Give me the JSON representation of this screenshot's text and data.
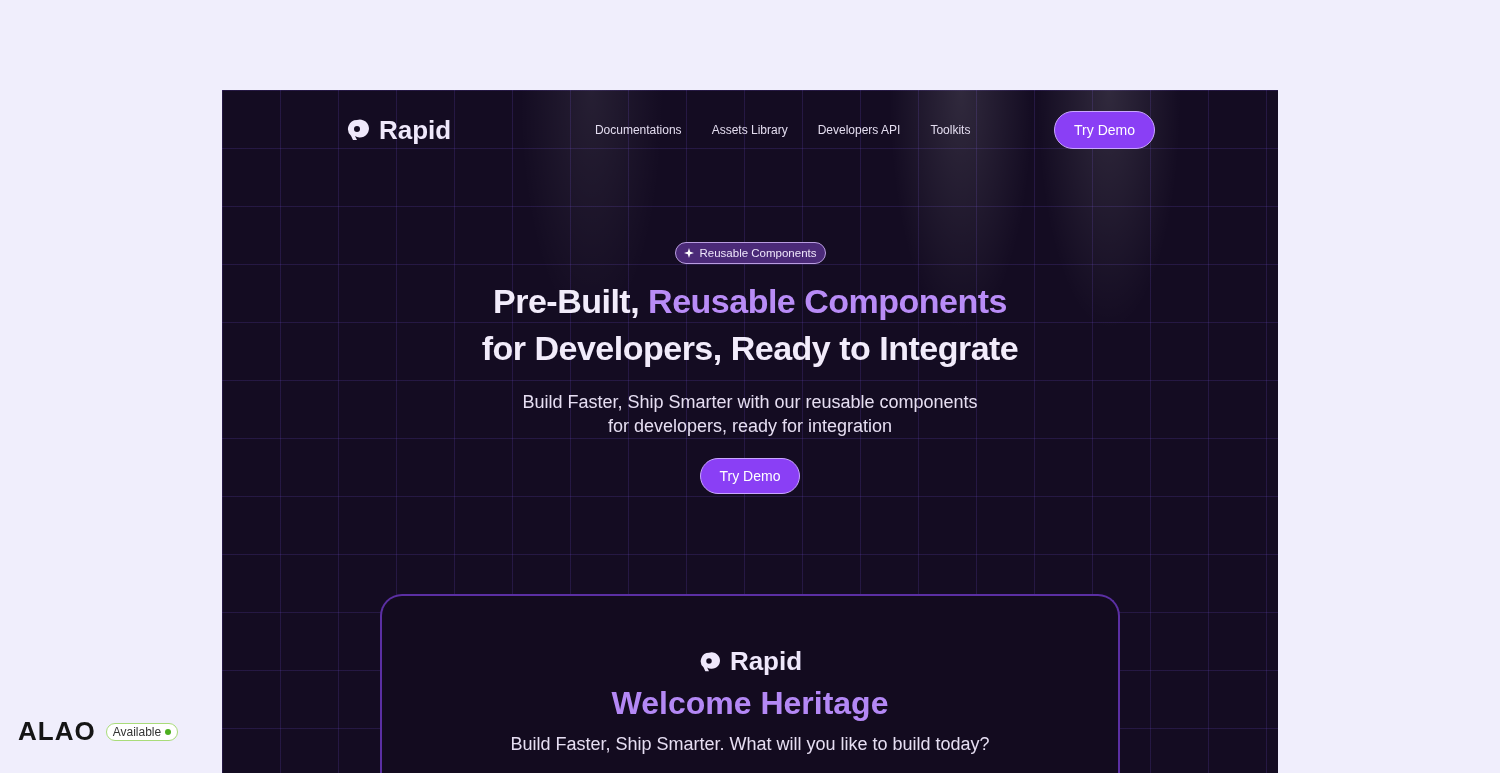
{
  "nav": {
    "brand": "Rapid",
    "links": [
      "Documentations",
      "Assets Library",
      "Developers API",
      "Toolkits"
    ],
    "cta": "Try Demo"
  },
  "hero": {
    "badge": "Reusable Components",
    "headline": [
      [
        {
          "text": "Pre-Built, ",
          "accent": false
        },
        {
          "text": "Reusable Components",
          "accent": true
        }
      ],
      [
        {
          "text": "for Developers, Ready to Integrate",
          "accent": false
        }
      ]
    ],
    "subtitle": [
      "Build Faster, Ship Smarter with our reusable components",
      "for developers, ready for integration"
    ],
    "cta": "Try Demo"
  },
  "card": {
    "brand": "Rapid",
    "title": "Welcome Heritage",
    "subtitle": "Build Faster, Ship Smarter. What will you like to build today?"
  },
  "attribution": {
    "name": "ALAO",
    "status": "Available",
    "color": "#4caf1f"
  }
}
